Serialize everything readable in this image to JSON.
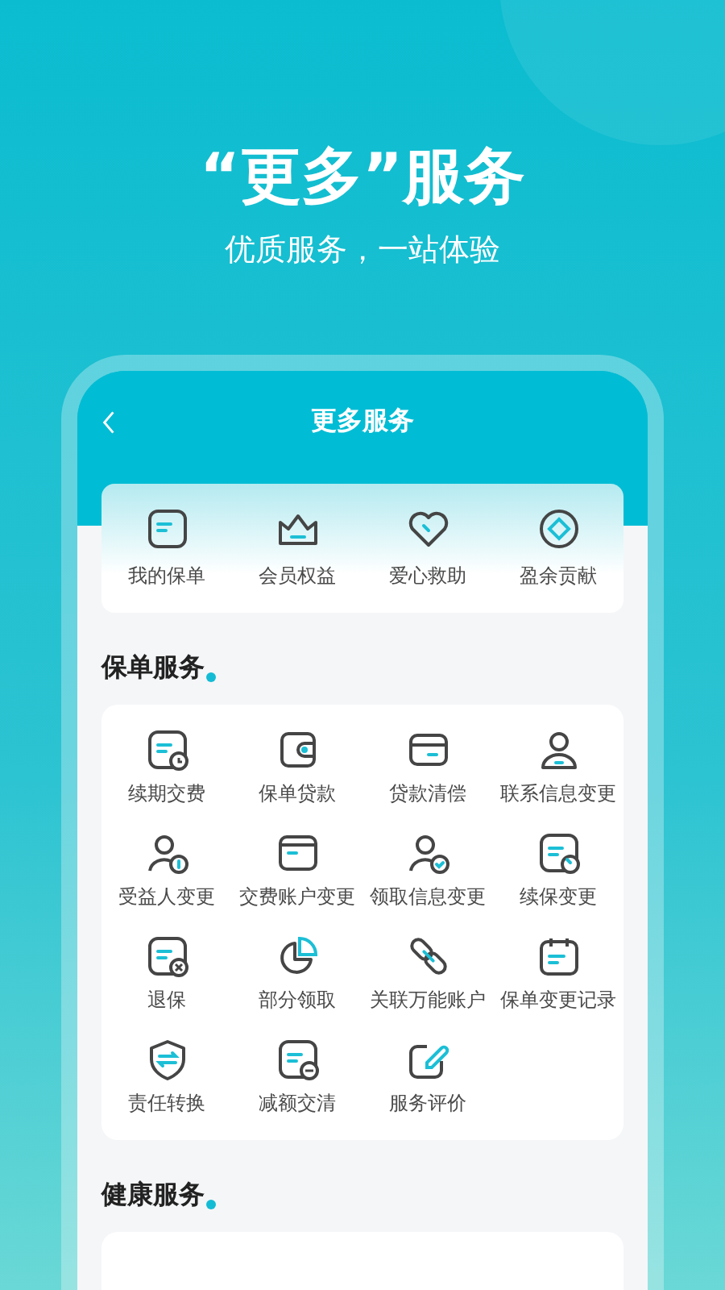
{
  "headline": "“更多”服务",
  "subheadline": "优质服务，一站体验",
  "screen": {
    "title": "更多服务",
    "quick_actions": [
      {
        "label": "我的保单"
      },
      {
        "label": "会员权益"
      },
      {
        "label": "爱心救助"
      },
      {
        "label": "盈余贡献"
      }
    ],
    "sections": [
      {
        "title": "保单服务",
        "items": [
          {
            "label": "续期交费"
          },
          {
            "label": "保单贷款"
          },
          {
            "label": "贷款清偿"
          },
          {
            "label": "联系信息变更"
          },
          {
            "label": "受益人变更"
          },
          {
            "label": "交费账户变更"
          },
          {
            "label": "领取信息变更"
          },
          {
            "label": "续保变更"
          },
          {
            "label": "退保"
          },
          {
            "label": "部分领取"
          },
          {
            "label": "关联万能账户"
          },
          {
            "label": "保单变更记录"
          },
          {
            "label": "责任转换"
          },
          {
            "label": "减额交清"
          },
          {
            "label": "服务评价"
          }
        ]
      },
      {
        "title": "健康服务"
      }
    ]
  }
}
